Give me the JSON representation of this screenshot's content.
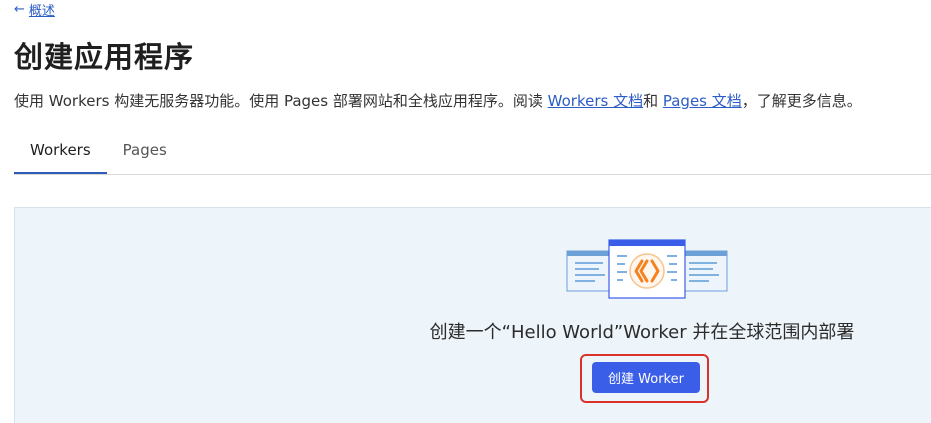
{
  "nav": {
    "back_arrow": "←",
    "back_label": "概述"
  },
  "page": {
    "title": "创建应用程序"
  },
  "description": {
    "text_before": "使用 Workers 构建无服务器功能。使用 Pages 部署网站和全栈应用程序。阅读 ",
    "link_workers_docs": "Workers 文档",
    "text_and": "和 ",
    "link_pages_docs": "Pages 文档",
    "text_after": "，了解更多信息。"
  },
  "tabs": [
    {
      "label": "Workers"
    },
    {
      "label": "Pages"
    }
  ],
  "panel": {
    "heading": "创建一个“Hello World”Worker 并在全球范围内部署",
    "button_label": "创建 Worker",
    "illustration_icon": "cloudflare-workers-logo-icon"
  },
  "colors": {
    "accent": "#3b5ee8",
    "link": "#2c5cc5",
    "highlight_border": "#d8322b",
    "panel_bg": "#edf5fb",
    "logo_orange": "#f6821f"
  }
}
